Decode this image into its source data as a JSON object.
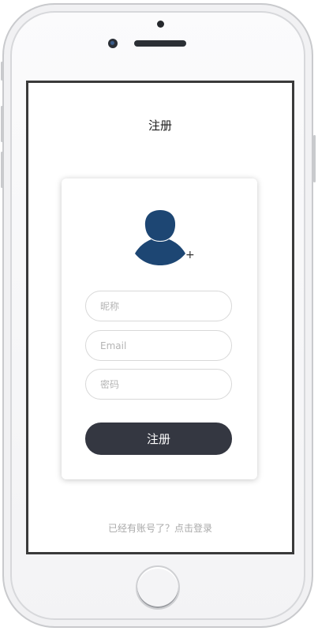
{
  "page": {
    "title": "注册"
  },
  "form": {
    "nickname_placeholder": "昵称",
    "email_placeholder": "Email",
    "password_placeholder": "密码",
    "submit_label": "注册"
  },
  "avatar": {
    "icon": "user-avatar-icon",
    "add_label": "+",
    "color": "#1d4673"
  },
  "footer": {
    "login_link": "已经有账号了？点击登录"
  },
  "colors": {
    "button_bg": "#343741",
    "button_text": "#ffffff",
    "link_text": "#a9a9a9",
    "field_border": "#d8d8d8"
  }
}
